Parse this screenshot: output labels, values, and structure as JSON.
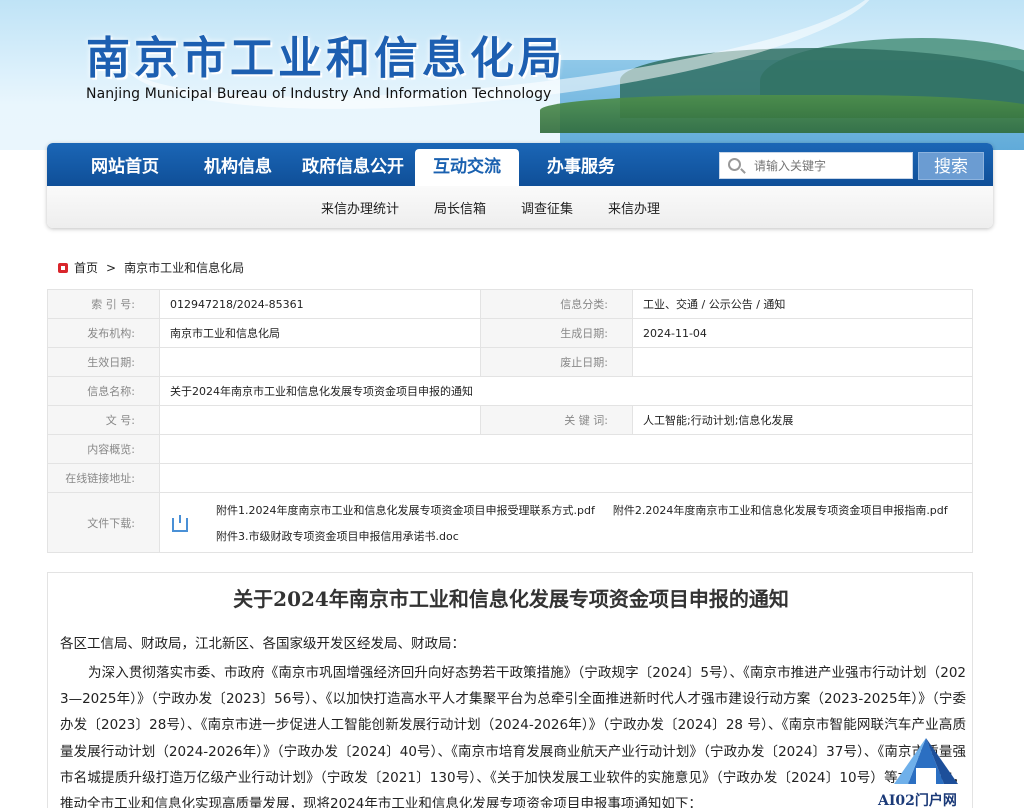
{
  "site": {
    "title_cn": "南京市工业和信息化局",
    "title_en": "Nanjing Municipal Bureau of Industry And Information Technology"
  },
  "nav": {
    "items": [
      "网站首页",
      "机构信息",
      "政府信息公开",
      "互动交流",
      "办事服务"
    ],
    "active": "互动交流",
    "search_placeholder": "请输入关键字",
    "search_button": "搜索",
    "sub_items": [
      "来信办理统计",
      "局长信箱",
      "调查征集",
      "来信办理"
    ]
  },
  "breadcrumb": [
    "首页",
    ">",
    "南京市工业和信息化局"
  ],
  "info": {
    "index_label": "索 引 号:",
    "index_value": "012947218/2024-85361",
    "category_label": "信息分类:",
    "category_value": "工业、交通 / 公示公告 / 通知",
    "publisher_label": "发布机构:",
    "publisher_value": "南京市工业和信息化局",
    "date_label": "生成日期:",
    "date_value": "2024-11-04",
    "effective_label": "生效日期:",
    "effective_value": "",
    "expire_label": "废止日期:",
    "expire_value": "",
    "name_label": "信息名称:",
    "name_value": "关于2024年南京市工业和信息化发展专项资金项目申报的通知",
    "docno_label": "文 号:",
    "docno_value": "",
    "keywords_label": "关 键 词:",
    "keywords_value": "人工智能;行动计划;信息化发展",
    "summary_label": "内容概览:",
    "summary_value": "",
    "link_label": "在线链接地址:",
    "link_value": "",
    "download_label": "文件下载:",
    "files": [
      "附件1.2024年度南京市工业和信息化发展专项资金项目申报受理联系方式.pdf",
      "附件2.2024年度南京市工业和信息化发展专项资金项目申报指南.pdf",
      "附件3.市级财政专项资金项目申报信用承诺书.doc"
    ]
  },
  "article": {
    "title": "关于2024年南京市工业和信息化发展专项资金项目申报的通知",
    "salutation": "各区工信局、财政局，江北新区、各国家级开发区经发局、财政局：",
    "paragraph": "为深入贯彻落实市委、市政府《南京市巩固增强经济回升向好态势若干政策措施》（宁政规字〔2024〕5号）、《南京市推进产业强市行动计划（2023—2025年）》（宁政办发〔2023〕56号）、《以加快打造高水平人才集聚平台为总牵引全面推进新时代人才强市建设行动方案（2023-2025年）》（宁委办发〔2023〕28号）、《南京市进一步促进人工智能创新发展行动计划（2024-2026年）》（宁政办发〔2024〕28 号）、《南京市智能网联汽车产业高质量发展行动计划（2024-2026年）》（宁政办发〔2024〕40号）、《南京市培育发展商业航天产业行动计划》（宁政办发〔2024〕37号）、《南京市质量强市名城提质升级打造万亿级产业行动计划》（宁政发〔2021〕130号）、《关于加快发展工业软件的实施意见》（宁政办发〔2024〕10号）等文件精神，推动全市工业和信息化实现高质量发展，现将2024年市工业和信息化发展专项资金项目申报事项通知如下："
  },
  "watermark": "AI02门户网"
}
